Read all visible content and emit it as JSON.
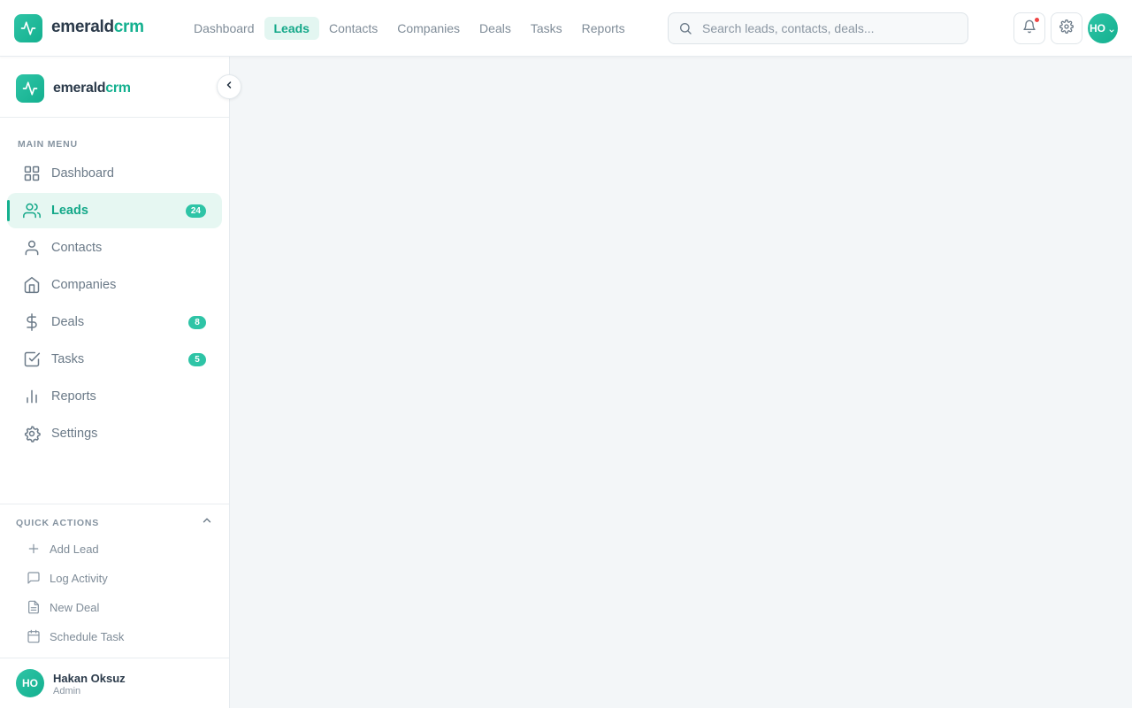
{
  "app": {
    "brand_part1": "emerald",
    "brand_part2": "crm",
    "accent_color": "#14b08f"
  },
  "topnav": {
    "items": [
      {
        "label": "Dashboard",
        "active": false
      },
      {
        "label": "Leads",
        "active": true
      },
      {
        "label": "Contacts",
        "active": false
      },
      {
        "label": "Companies",
        "active": false
      },
      {
        "label": "Deals",
        "active": false
      },
      {
        "label": "Tasks",
        "active": false
      },
      {
        "label": "Reports",
        "active": false
      }
    ]
  },
  "search": {
    "placeholder": "Search leads, contacts, deals...",
    "value": ""
  },
  "header": {
    "avatar_initials": "HO",
    "has_notification": true
  },
  "sidebar": {
    "menu_title": "MAIN MENU",
    "items": [
      {
        "label": "Dashboard",
        "icon": "grid-icon",
        "badge": null,
        "active": false
      },
      {
        "label": "Leads",
        "icon": "users-icon",
        "badge": "24",
        "active": true
      },
      {
        "label": "Contacts",
        "icon": "user-icon",
        "badge": null,
        "active": false
      },
      {
        "label": "Companies",
        "icon": "home-icon",
        "badge": null,
        "active": false
      },
      {
        "label": "Deals",
        "icon": "dollar-icon",
        "badge": "8",
        "active": false
      },
      {
        "label": "Tasks",
        "icon": "check-square-icon",
        "badge": "5",
        "active": false
      },
      {
        "label": "Reports",
        "icon": "bar-chart-icon",
        "badge": null,
        "active": false
      },
      {
        "label": "Settings",
        "icon": "settings-icon",
        "badge": null,
        "active": false
      }
    ],
    "quick_actions_title": "QUICK ACTIONS",
    "quick_actions": [
      {
        "label": "Add Lead",
        "icon": "plus-icon"
      },
      {
        "label": "Log Activity",
        "icon": "message-icon"
      },
      {
        "label": "New Deal",
        "icon": "file-icon"
      },
      {
        "label": "Schedule Task",
        "icon": "calendar-icon"
      }
    ],
    "user": {
      "initials": "HO",
      "name": "Hakan Oksuz",
      "role": "Admin"
    }
  }
}
